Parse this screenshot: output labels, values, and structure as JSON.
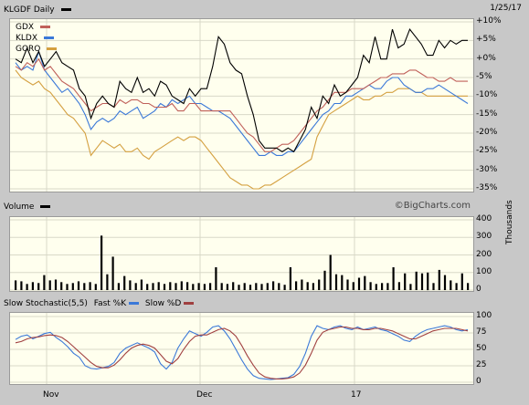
{
  "header": {
    "title": "KLGDF Daily",
    "date": "1/25/17",
    "credit": "©BigCharts.com"
  },
  "price_panel": {
    "legend": [
      {
        "label": "GDX",
        "color": "#c0605a"
      },
      {
        "label": "KLDX",
        "color": "#3a78d8"
      },
      {
        "label": "GORO",
        "color": "#d4a040"
      }
    ]
  },
  "volume_panel": {
    "label": "Volume",
    "unit": "Thousands"
  },
  "stoch_panel": {
    "label": "Slow Stochastic(5,5)",
    "fast_label": "Fast %K",
    "slow_label": "Slow %D"
  },
  "chart_data": [
    {
      "type": "line",
      "title": "KLGDF Daily",
      "yticks": [
        "+10%",
        "+5%",
        "+0%",
        "-5%",
        "-10%",
        "-15%",
        "-20%",
        "-25%",
        "-30%",
        "-35%"
      ],
      "ylim": [
        -35,
        10
      ],
      "xticks": [
        "Nov",
        "Dec",
        "17"
      ],
      "series": [
        {
          "name": "KLGDF",
          "color": "#000000",
          "values": [
            0,
            -1,
            3,
            -1,
            2,
            -2,
            0,
            2,
            -1,
            -2,
            -3,
            -8,
            -10,
            -16,
            -12,
            -10,
            -12,
            -13,
            -6,
            -8,
            -9,
            -5,
            -9,
            -8,
            -10,
            -6,
            -7,
            -10,
            -11,
            -12,
            -8,
            -10,
            -8,
            -8,
            -2,
            6,
            4,
            -1,
            -3,
            -4,
            -10,
            -15,
            -22,
            -24,
            -24,
            -24,
            -25,
            -24,
            -25,
            -22,
            -19,
            -13,
            -16,
            -10,
            -12,
            -7,
            -10,
            -9,
            -7,
            -5,
            1,
            -1,
            6,
            0,
            0,
            8,
            3,
            4,
            8,
            6,
            4,
            1,
            1,
            5,
            3,
            5,
            4,
            5,
            5
          ]
        },
        {
          "name": "GDX",
          "color": "#c0605a",
          "values": [
            -2,
            -3,
            -1,
            -2,
            0,
            -3,
            -2,
            -4,
            -6,
            -7,
            -8,
            -10,
            -12,
            -14,
            -13,
            -12,
            -12,
            -13,
            -11,
            -12,
            -11,
            -11,
            -12,
            -12,
            -13,
            -13,
            -13,
            -12,
            -14,
            -14,
            -12,
            -12,
            -14,
            -14,
            -14,
            -14,
            -14,
            -14,
            -16,
            -18,
            -20,
            -21,
            -23,
            -25,
            -25,
            -24,
            -23,
            -23,
            -22,
            -20,
            -18,
            -16,
            -14,
            -13,
            -11,
            -9,
            -9,
            -9,
            -8,
            -8,
            -8,
            -7,
            -6,
            -5,
            -5,
            -4,
            -4,
            -4,
            -3,
            -3,
            -4,
            -5,
            -5,
            -6,
            -6,
            -5,
            -6,
            -6,
            -6
          ]
        },
        {
          "name": "KLDX",
          "color": "#3a78d8",
          "values": [
            -1,
            -3,
            -2,
            -3,
            2,
            -3,
            -5,
            -7,
            -9,
            -8,
            -10,
            -12,
            -15,
            -19,
            -17,
            -16,
            -17,
            -16,
            -14,
            -15,
            -14,
            -13,
            -16,
            -15,
            -14,
            -12,
            -13,
            -11,
            -12,
            -11,
            -10,
            -12,
            -12,
            -13,
            -14,
            -14,
            -15,
            -16,
            -18,
            -20,
            -22,
            -24,
            -26,
            -26,
            -25,
            -26,
            -26,
            -25,
            -25,
            -23,
            -21,
            -19,
            -17,
            -15,
            -14,
            -12,
            -12,
            -10,
            -10,
            -9,
            -8,
            -7,
            -8,
            -8,
            -6,
            -5,
            -5,
            -7,
            -8,
            -9,
            -9,
            -8,
            -8,
            -7,
            -8,
            -9,
            -10,
            -11,
            -12
          ]
        },
        {
          "name": "GORO",
          "color": "#d4a040",
          "values": [
            -3,
            -5,
            -6,
            -7,
            -6,
            -8,
            -9,
            -11,
            -13,
            -15,
            -16,
            -18,
            -20,
            -26,
            -24,
            -22,
            -23,
            -24,
            -23,
            -25,
            -25,
            -24,
            -26,
            -27,
            -25,
            -24,
            -23,
            -22,
            -21,
            -22,
            -21,
            -21,
            -22,
            -24,
            -26,
            -28,
            -30,
            -32,
            -33,
            -34,
            -34,
            -35,
            -35,
            -34,
            -34,
            -33,
            -32,
            -31,
            -30,
            -29,
            -28,
            -27,
            -21,
            -18,
            -15,
            -14,
            -13,
            -12,
            -11,
            -10,
            -11,
            -11,
            -10,
            -10,
            -9,
            -9,
            -8,
            -8,
            -8,
            -9,
            -9,
            -10,
            -10,
            -10,
            -10,
            -10,
            -10,
            -10,
            -10
          ]
        }
      ]
    },
    {
      "type": "bar",
      "title": "Volume",
      "ylabel": "Thousands",
      "yticks": [
        "400",
        "300",
        "200",
        "100",
        "0"
      ],
      "ylim": [
        0,
        400
      ],
      "values": [
        55,
        50,
        35,
        45,
        40,
        85,
        55,
        60,
        45,
        35,
        40,
        50,
        40,
        45,
        35,
        310,
        90,
        190,
        40,
        80,
        55,
        40,
        60,
        35,
        40,
        45,
        35,
        45,
        40,
        50,
        45,
        35,
        40,
        35,
        40,
        130,
        40,
        35,
        45,
        30,
        40,
        30,
        40,
        35,
        40,
        50,
        40,
        30,
        130,
        50,
        60,
        45,
        40,
        60,
        110,
        200,
        90,
        85,
        60,
        45,
        70,
        80,
        45,
        35,
        40,
        40,
        130,
        45,
        95,
        35,
        105,
        95,
        100,
        40,
        115,
        85,
        55,
        40,
        95,
        40
      ]
    },
    {
      "type": "line",
      "title": "Slow Stochastic(5,5)",
      "yticks": [
        "100",
        "75",
        "50",
        "25",
        "0"
      ],
      "ylim": [
        0,
        100
      ],
      "series": [
        {
          "name": "Fast %K",
          "color": "#3a78d8",
          "values": [
            65,
            70,
            72,
            66,
            70,
            74,
            76,
            68,
            62,
            54,
            44,
            38,
            25,
            21,
            20,
            22,
            24,
            30,
            44,
            52,
            56,
            60,
            56,
            52,
            46,
            28,
            20,
            30,
            52,
            66,
            78,
            74,
            70,
            76,
            84,
            86,
            78,
            66,
            50,
            34,
            20,
            10,
            6,
            5,
            4,
            5,
            6,
            7,
            12,
            24,
            44,
            70,
            86,
            82,
            80,
            84,
            86,
            82,
            80,
            84,
            80,
            82,
            84,
            80,
            78,
            74,
            70,
            64,
            62,
            70,
            76,
            80,
            82,
            84,
            86,
            84,
            80,
            78,
            80
          ]
        },
        {
          "name": "Slow %D",
          "color": "#a04040",
          "values": [
            60,
            62,
            66,
            68,
            69,
            71,
            72,
            71,
            68,
            62,
            54,
            46,
            38,
            30,
            24,
            22,
            22,
            26,
            34,
            44,
            52,
            56,
            58,
            56,
            52,
            42,
            32,
            28,
            36,
            50,
            62,
            70,
            72,
            72,
            76,
            80,
            82,
            78,
            70,
            56,
            40,
            26,
            14,
            8,
            6,
            5,
            5,
            6,
            8,
            14,
            26,
            44,
            64,
            76,
            80,
            82,
            84,
            84,
            82,
            82,
            80,
            80,
            82,
            82,
            80,
            78,
            74,
            70,
            66,
            66,
            70,
            74,
            78,
            80,
            82,
            82,
            82,
            80,
            78
          ]
        }
      ]
    }
  ]
}
